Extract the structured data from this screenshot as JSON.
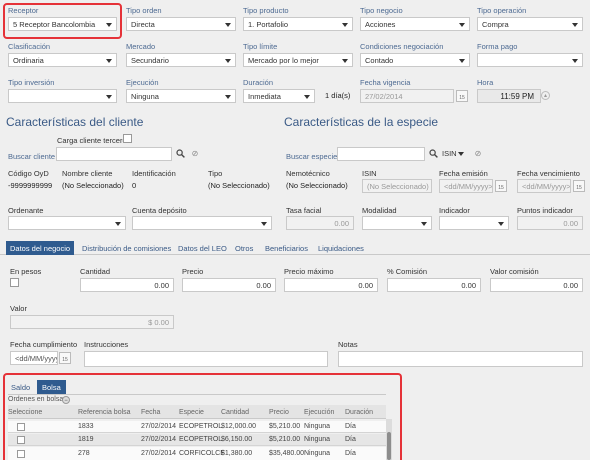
{
  "orden": {
    "receptor": {
      "label": "Receptor",
      "value": "5 Receptor Bancolombia"
    },
    "tipo_orden": {
      "label": "Tipo orden",
      "value": "Directa"
    },
    "tipo_producto": {
      "label": "Tipo producto",
      "value": "1. Portafolio"
    },
    "tipo_negocio": {
      "label": "Tipo negocio",
      "value": "Acciones"
    },
    "tipo_operacion": {
      "label": "Tipo operación",
      "value": "Compra"
    },
    "clasificacion": {
      "label": "Clasificación",
      "value": "Ordinaria"
    },
    "mercado": {
      "label": "Mercado",
      "value": "Secundario"
    },
    "tipo_limite": {
      "label": "Tipo límite",
      "value": "Mercado por lo mejor"
    },
    "condiciones_negociacion": {
      "label": "Condiciones negociación",
      "value": "Contado"
    },
    "forma_pago": {
      "label": "Forma pago",
      "value": ""
    },
    "tipo_inversion": {
      "label": "Tipo inversión",
      "value": ""
    },
    "ejecucion": {
      "label": "Ejecución",
      "value": "Ninguna"
    },
    "duracion": {
      "label": "Duración",
      "value": "Inmediata",
      "dias": "1 día(s)"
    },
    "fecha_vigencia": {
      "label": "Fecha vigencia",
      "value": "27/02/2014",
      "cal": "15"
    },
    "hora": {
      "label": "Hora",
      "value": "11:59 PM"
    }
  },
  "cliente": {
    "title": "Características del cliente",
    "carga_tercero": "Carga cliente tercero",
    "buscar_label": "Buscar cliente",
    "codigo_label": "Código OyD",
    "codigo_value": "-9999999999",
    "nombre_label": "Nombre cliente",
    "nombre_value": "(No Seleccionado)",
    "identificacion_label": "Identificación",
    "identificacion_value": "0",
    "tipo_label": "Tipo",
    "tipo_value": "(No Seleccionado)",
    "ordenante_label": "Ordenante",
    "cuenta_label": "Cuenta depósito"
  },
  "especie": {
    "title": "Características de la especie",
    "buscar_label": "Buscar especie",
    "isin_select": "ISIN",
    "nemotecnico_label": "Nemotécnico",
    "nemotecnico_value": "(No Seleccionado)",
    "isin_label": "ISIN",
    "isin_value": "(No Seleccionado)",
    "fecha_emision_label": "Fecha emisión",
    "fecha_emision_placeholder": "<dd/MM/yyyy>",
    "fecha_venc_label": "Fecha vencimiento",
    "fecha_venc_placeholder": "<dd/MM/yyyy>",
    "tasa_facial_label": "Tasa facial",
    "tasa_facial_value": "0.00",
    "modalidad_label": "Modalidad",
    "indicador_label": "Indicador",
    "puntos_label": "Puntos indicador",
    "puntos_value": "0.00"
  },
  "tabs": [
    "Datos del negocio",
    "Distribución de comisiones",
    "Datos del LEO",
    "Otros",
    "Beneficiarios",
    "Liquidaciones"
  ],
  "negocio": {
    "en_pesos": "En pesos",
    "cantidad_label": "Cantidad",
    "cantidad_value": "0.00",
    "precio_label": "Precio",
    "precio_value": "0.00",
    "precio_max_label": "Precio máximo",
    "precio_max_value": "0.00",
    "comision_label": "% Comisión",
    "comision_value": "0.00",
    "valor_comision_label": "Valor comisión",
    "valor_comision_value": "0.00",
    "valor_label": "Valor",
    "valor_value": "$ 0.00",
    "fecha_cumpl_label": "Fecha cumplimiento",
    "fecha_cumpl_placeholder": "<dd/MM/yyyy>",
    "instrucciones_label": "Instrucciones",
    "notas_label": "Notas"
  },
  "bottom": {
    "tabs": [
      "Saldo",
      "Bolsa"
    ],
    "ordenes_label": "Ordenes en bolsa",
    "columns": [
      "Seleccione",
      "Referencia bolsa",
      "Fecha",
      "Especie",
      "Cantidad",
      "Precio",
      "Ejecución",
      "Duración"
    ],
    "rows": [
      [
        "1833",
        "27/02/2014",
        "ECOPETROL",
        "$12,000.00",
        "$5,210.00",
        "Ninguna",
        "Día"
      ],
      [
        "1819",
        "27/02/2014",
        "ECOPETROL",
        "$6,150.00",
        "$5,210.00",
        "Ninguna",
        "Día"
      ],
      [
        "278",
        "27/02/2014",
        "CORFICOLCF",
        "$1,380.00",
        "$35,480.00",
        "Ninguna",
        "Día"
      ]
    ]
  },
  "colors": {
    "accent": "#2f5b8f",
    "highlight_box": "#e53238",
    "label": "#4d6a92"
  }
}
